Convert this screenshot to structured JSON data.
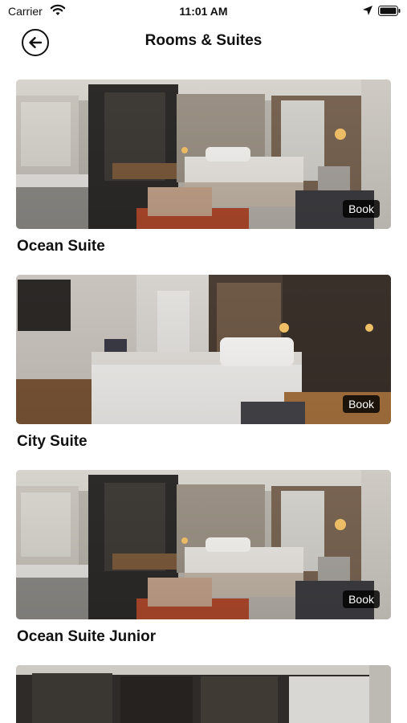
{
  "status_bar": {
    "carrier": "Carrier",
    "time": "11:01 AM"
  },
  "header": {
    "title": "Rooms & Suites"
  },
  "rooms": [
    {
      "name": "Ocean Suite",
      "action": "Book"
    },
    {
      "name": "City Suite",
      "action": "Book"
    },
    {
      "name": "Ocean Suite Junior",
      "action": "Book"
    }
  ],
  "colors": {
    "text": "#111111",
    "book_badge_bg": "#000000",
    "book_badge_text": "#ffffff"
  }
}
